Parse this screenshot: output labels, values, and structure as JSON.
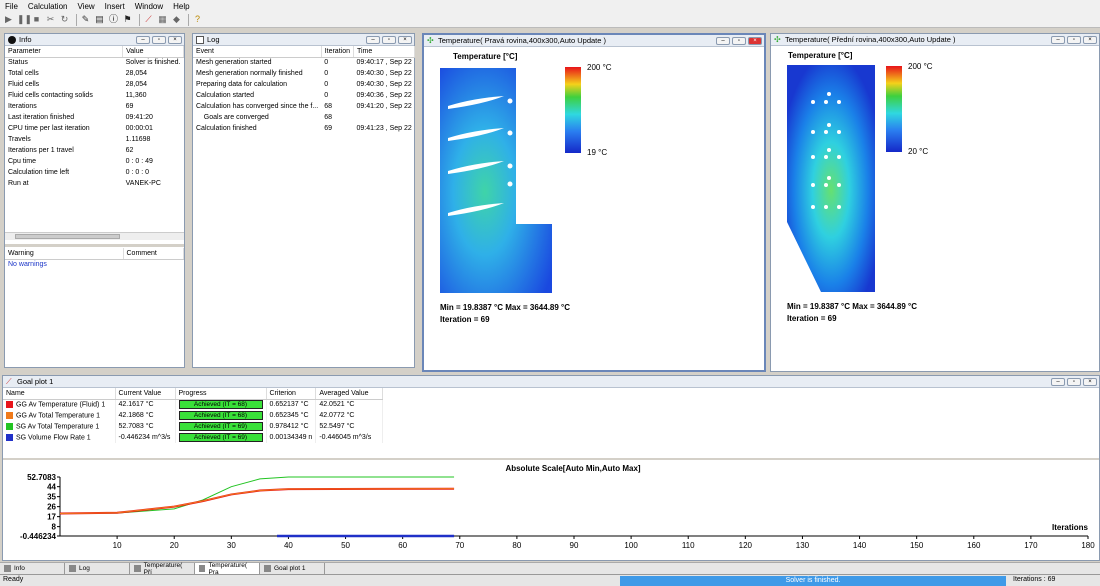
{
  "menu": [
    "File",
    "Calculation",
    "View",
    "Insert",
    "Window",
    "Help"
  ],
  "info": {
    "title": "Info",
    "cols": [
      "Parameter",
      "Value"
    ],
    "rows": [
      [
        "Status",
        "Solver is finished."
      ],
      [
        "Total cells",
        "28,054"
      ],
      [
        "Fluid cells",
        "28,054"
      ],
      [
        "Fluid cells contacting solids",
        "11,360"
      ],
      [
        "Iterations",
        "69"
      ],
      [
        "Last iteration finished",
        "09:41:20"
      ],
      [
        "CPU time per last iteration",
        "00:00:01"
      ],
      [
        "Travels",
        "1.11698"
      ],
      [
        "Iterations per 1 travel",
        "62"
      ],
      [
        "Cpu time",
        "0 : 0 : 49"
      ],
      [
        "Calculation time left",
        "0 : 0 : 0"
      ],
      [
        "Run at",
        "VANEK-PC"
      ]
    ],
    "warn_cols": [
      "Warning",
      "Comment"
    ],
    "warning": "No warnings"
  },
  "log": {
    "title": "Log",
    "cols": [
      "Event",
      "Iteration",
      "Time"
    ],
    "rows": [
      [
        "Mesh generation started",
        "0",
        "09:40:17 , Sep 22"
      ],
      [
        "Mesh generation normally finished",
        "0",
        "09:40:30 , Sep 22"
      ],
      [
        "Preparing data for calculation",
        "0",
        "09:40:30 , Sep 22"
      ],
      [
        "Calculation started",
        "0",
        "09:40:36 , Sep 22"
      ],
      [
        "Calculation has converged since the f...",
        "68",
        "09:41:20 , Sep 22"
      ],
      [
        "    Goals are converged",
        "68",
        ""
      ],
      [
        "Calculation finished",
        "69",
        "09:41:23 , Sep 22"
      ]
    ]
  },
  "temp1": {
    "title": "Temperature( Pravá rovina,400x300,Auto Update )",
    "legend_title": "Temperature [°C]",
    "max_label": "200 °C",
    "min_label": "19 °C",
    "minmax": "Min = 19.8387 °C   Max = 3644.89 °C",
    "iter": "Iteration = 69"
  },
  "temp2": {
    "title": "Temperature( Přední rovina,400x300,Auto Update )",
    "legend_title": "Temperature [°C]",
    "max_label": "200 °C",
    "min_label": "20 °C",
    "minmax": "Min = 19.8387 °C   Max = 3644.89 °C",
    "iter": "Iteration = 69"
  },
  "goal": {
    "title": "Goal plot 1",
    "cols": [
      "Name",
      "Current Value",
      "Progress",
      "Criterion",
      "Averaged Value"
    ],
    "rows": [
      {
        "name": "GG Av Temperature (Fluid) 1",
        "value": "42.1617 °C",
        "progress": "Achieved (IT = 68)",
        "criterion": "0.652137 °C",
        "avg": "42.0521 °C",
        "color": "#e8141a"
      },
      {
        "name": "GG Av Total Temperature 1",
        "value": "42.1868 °C",
        "progress": "Achieved (IT = 68)",
        "criterion": "0.652345 °C",
        "avg": "42.0772 °C",
        "color": "#f07a1a"
      },
      {
        "name": "SG Av Total Temperature 1",
        "value": "52.7083 °C",
        "progress": "Achieved (IT = 69)",
        "criterion": "0.978412 °C",
        "avg": "52.5497 °C",
        "color": "#22c422"
      },
      {
        "name": "SG Volume Flow Rate 1",
        "value": "-0.446234 m^3/s",
        "progress": "Achieved (IT = 69)",
        "criterion": "0.00134349 n",
        "avg": "-0.446045 m^3/s",
        "color": "#2030c8"
      }
    ]
  },
  "chart_data": {
    "type": "line",
    "title": "Absolute Scale[Auto Min,Auto Max]",
    "xlabel": "Iterations",
    "ylabel": "",
    "xlim": [
      0,
      110
    ],
    "ylim": [
      -0.446234,
      52.7083
    ],
    "x_ticks": [
      "10",
      "20",
      "30",
      "40",
      "50",
      "60",
      "70",
      "80",
      "90",
      "100",
      "110",
      "120",
      "130",
      "140",
      "150",
      "160",
      "170",
      "180"
    ],
    "y_ticks": [
      "52.7083",
      "44",
      "35",
      "26",
      "17",
      "8",
      "-0.446234"
    ],
    "series": [
      {
        "color": "#22c422",
        "x": [
          0,
          10,
          20,
          25,
          30,
          35,
          40,
          69
        ],
        "y": [
          19.8,
          20.2,
          24,
          32,
          44,
          51,
          52.7,
          52.7
        ]
      },
      {
        "color": "#e8141a",
        "x": [
          0,
          10,
          20,
          25,
          30,
          35,
          40,
          69
        ],
        "y": [
          19.8,
          20.5,
          26,
          31,
          37,
          40.5,
          41.8,
          42.16
        ]
      },
      {
        "color": "#f07a1a",
        "x": [
          0,
          10,
          20,
          25,
          30,
          35,
          40,
          69
        ],
        "y": [
          19.8,
          20.5,
          26.1,
          31.1,
          37.1,
          40.6,
          41.9,
          42.19
        ]
      },
      {
        "color": "#2030c8",
        "x": [
          38,
          69
        ],
        "y": [
          -0.446,
          -0.446
        ]
      }
    ]
  },
  "tabs": [
    "Info",
    "Log",
    "Temperature( Pří",
    "Temperature( Pra",
    "Goal plot 1"
  ],
  "status": {
    "left": "Ready",
    "center": "Solver is finished.",
    "right": "Iterations : 69"
  }
}
